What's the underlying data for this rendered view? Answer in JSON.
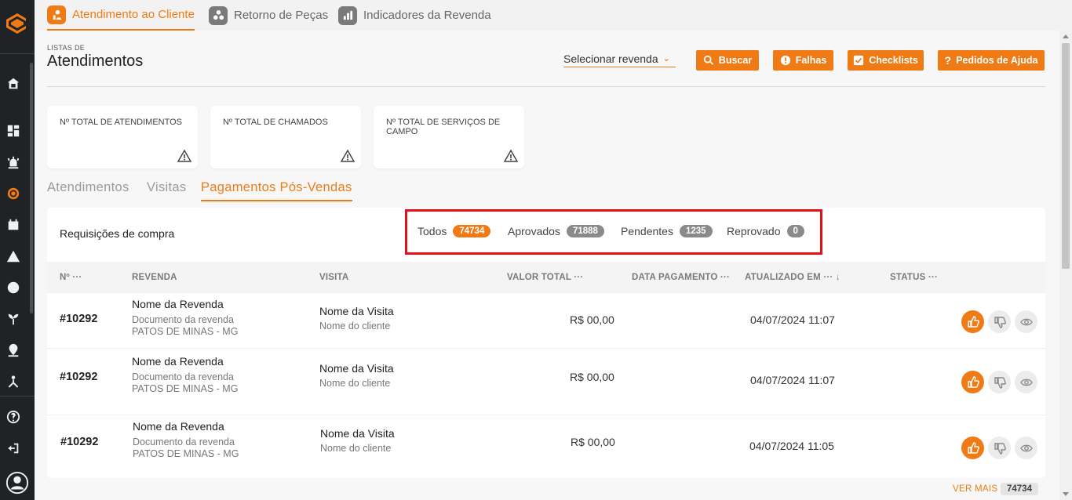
{
  "top_tabs": [
    {
      "label": "Atendimento ao Cliente",
      "active": true
    },
    {
      "label": "Retorno de Peças",
      "active": false
    },
    {
      "label": "Indicadores da Revenda",
      "active": false
    }
  ],
  "header": {
    "small_caption": "LISTAS DE",
    "title": "Atendimentos",
    "select_placeholder": "Selecionar revenda",
    "buttons": {
      "buscar": "Buscar",
      "falhas": "Falhas",
      "checklists": "Checklists",
      "ajuda": "Pedidos de Ajuda"
    }
  },
  "cards": [
    {
      "label": "Nº TOTAL DE ATENDIMENTOS"
    },
    {
      "label": "Nº TOTAL DE CHAMADOS"
    },
    {
      "label": "Nº TOTAL DE SERVIÇOS DE CAMPO"
    }
  ],
  "sub_tabs": [
    {
      "label": "Atendimentos",
      "active": false
    },
    {
      "label": "Visitas",
      "active": false
    },
    {
      "label": "Pagamentos Pós-Vendas",
      "active": true
    }
  ],
  "panel": {
    "title": "Requisições de compra",
    "filters": [
      {
        "label": "Todos",
        "count": "74734"
      },
      {
        "label": "Aprovados",
        "count": "71888"
      },
      {
        "label": "Pendentes",
        "count": "1235"
      },
      {
        "label": "Reprovado",
        "count": "0"
      }
    ],
    "columns": {
      "num": "Nº ···",
      "revenda": "REVENDA",
      "visita": "VISITA",
      "valor": "VALOR TOTAL ···",
      "data_pag": "DATA PAGAMENTO ···",
      "atualizado": "ATUALIZADO EM ··· ↓",
      "status": "STATUS ···"
    },
    "rows": [
      {
        "num": "#10292",
        "revenda": "Nome da Revenda",
        "doc": "Documento da revenda",
        "local": "PATOS DE MINAS - MG",
        "visita": "Nome da Visita",
        "cliente": "Nome do cliente",
        "valor": "R$ 00,00",
        "atualizado": "04/07/2024 11:07"
      },
      {
        "num": "#10292",
        "revenda": "Nome da Revenda",
        "doc": "Documento da revenda",
        "local": "PATOS DE MINAS - MG",
        "visita": "Nome da Visita",
        "cliente": "Nome do cliente",
        "valor": "R$ 00,00",
        "atualizado": "04/07/2024 11:07"
      },
      {
        "num": "#10292",
        "revenda": "Nome da Revenda",
        "doc": "Documento da revenda",
        "local": "PATOS DE MINAS - MG",
        "visita": "Nome da Visita",
        "cliente": "Nome do cliente",
        "valor": "R$ 00,00",
        "atualizado": "04/07/2024 11:05"
      }
    ]
  },
  "footer": {
    "ver_mais": "VER MAIS",
    "total": "74734"
  },
  "colors": {
    "accent": "#f07b14",
    "sidebar": "#1f2326",
    "highlight": "#e3101a"
  }
}
